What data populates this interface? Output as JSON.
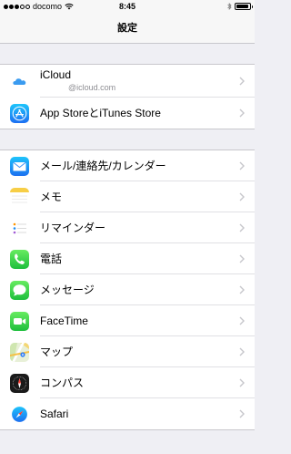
{
  "status_bar": {
    "carrier": "docomo",
    "time": "8:45",
    "battery_level": 0.95
  },
  "nav": {
    "title": "設定"
  },
  "groups": [
    {
      "items": [
        {
          "label": "iCloud",
          "sublabel": "@icloud.com",
          "icon": "icloud-icon"
        },
        {
          "label": "App StoreとiTunes Store",
          "icon": "app-store-icon"
        }
      ]
    },
    {
      "items": [
        {
          "label": "メール/連絡先/カレンダー",
          "icon": "mail-icon"
        },
        {
          "label": "メモ",
          "icon": "notes-icon"
        },
        {
          "label": "リマインダー",
          "icon": "reminders-icon"
        },
        {
          "label": "電話",
          "icon": "phone-icon"
        },
        {
          "label": "メッセージ",
          "icon": "messages-icon"
        },
        {
          "label": "FaceTime",
          "icon": "facetime-icon"
        },
        {
          "label": "マップ",
          "icon": "maps-icon"
        },
        {
          "label": "コンパス",
          "icon": "compass-icon"
        },
        {
          "label": "Safari",
          "icon": "safari-icon"
        }
      ]
    }
  ]
}
